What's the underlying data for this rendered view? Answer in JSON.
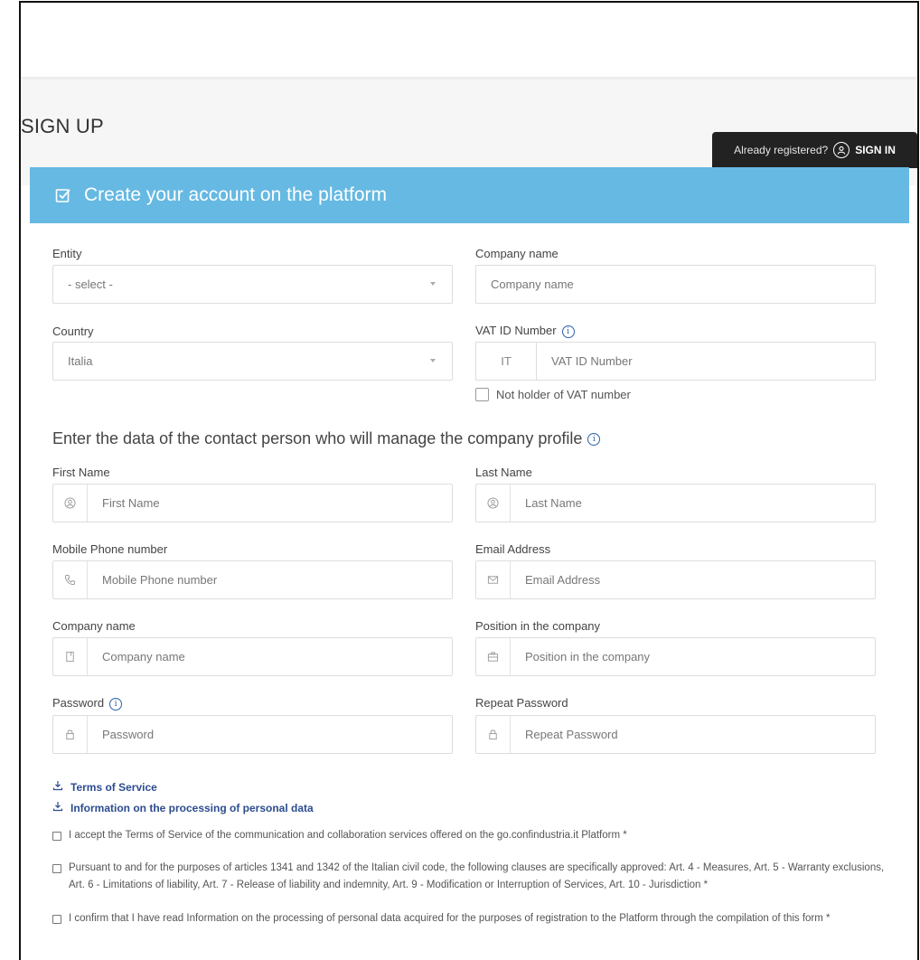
{
  "page": {
    "title": "SIGN UP"
  },
  "signin": {
    "question": "Already registered?",
    "label": "SIGN IN"
  },
  "header": {
    "title": "Create your account on the platform"
  },
  "company": {
    "entity_label": "Entity",
    "entity_value": "- select -",
    "company_name_label": "Company name",
    "company_name_placeholder": "Company name",
    "country_label": "Country",
    "country_value": "Italia",
    "vat_label": "VAT ID Number",
    "vat_prefix": "IT",
    "vat_placeholder": "VAT ID Number",
    "no_vat_label": "Not holder of VAT number"
  },
  "contact": {
    "section_title": "Enter the data of the contact person who will manage the company profile",
    "first_name_label": "First Name",
    "first_name_placeholder": "First Name",
    "last_name_label": "Last Name",
    "last_name_placeholder": "Last Name",
    "mobile_label": "Mobile Phone number",
    "mobile_placeholder": "Mobile Phone number",
    "email_label": "Email Address",
    "email_placeholder": "Email Address",
    "company_label": "Company name",
    "company_placeholder": "Company name",
    "position_label": "Position in the company",
    "position_placeholder": "Position in the company",
    "password_label": "Password",
    "password_placeholder": "Password",
    "repeat_label": "Repeat Password",
    "repeat_placeholder": "Repeat Password"
  },
  "links": {
    "terms": "Terms of Service",
    "privacy": "Information on the processing of personal data"
  },
  "consents": [
    "I accept the Terms of Service of the communication and collaboration services offered on the go.confindustria.it Platform *",
    "Pursuant to and for the purposes of articles 1341 and 1342 of the Italian civil code, the following clauses are specifically approved: Art. 4 - Measures, Art. 5 - Warranty exclusions, Art. 6 - Limitations of liability, Art. 7 - Release of liability and indemnity, Art. 9 - Modification or Interruption of Services, Art. 10 - Jurisdiction *",
    "I confirm that I have read Information on the processing of personal data acquired for the purposes of registration to the Platform through the compilation of this form *"
  ],
  "icons": {
    "header": "checkbox-icon",
    "signin": "user-circle-icon",
    "info": "info-icon",
    "user": "user-icon",
    "phone": "phone-icon",
    "email": "envelope-icon",
    "company": "building-icon",
    "position": "briefcase-icon",
    "lock": "lock-icon",
    "download": "download-icon"
  },
  "colors": {
    "accent": "#66b9e2",
    "dark": "#222222",
    "link": "#2c4c8f"
  }
}
